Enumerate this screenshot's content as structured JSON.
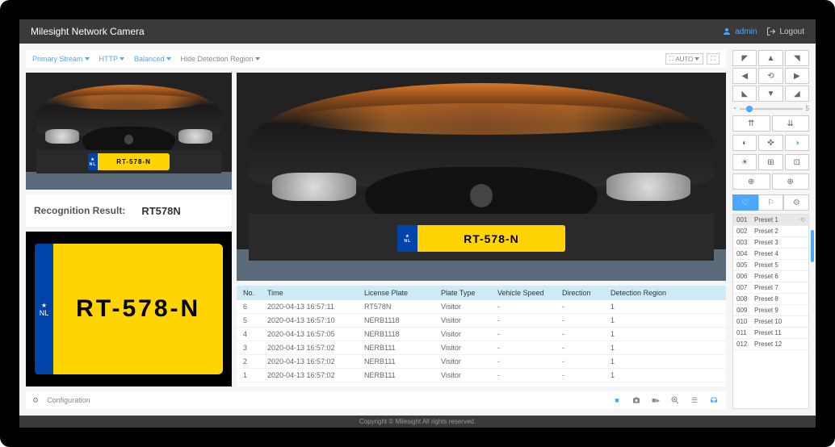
{
  "header": {
    "title": "Milesight Network Camera",
    "user": "admin",
    "logout": "Logout"
  },
  "toolbar": {
    "stream": "Primary Stream",
    "proto": "HTTP",
    "mode": "Balanced",
    "hide": "Hide Detection Region",
    "auto": "AUTO"
  },
  "plate": {
    "text": "RT-578-N",
    "country": "NL"
  },
  "recognition": {
    "label": "Recognition Result:",
    "value": "RT578N"
  },
  "table": {
    "headers": {
      "no": "No.",
      "time": "Time",
      "plate": "License Plate",
      "type": "Plate Type",
      "speed": "Vehicle Speed",
      "dir": "Direction",
      "region": "Detection Region"
    },
    "rows": [
      {
        "no": "6",
        "time": "2020-04-13 16:57:11",
        "plate": "RT578N",
        "type": "Visitor",
        "speed": "-",
        "dir": "-",
        "region": "1"
      },
      {
        "no": "5",
        "time": "2020-04-13 16:57:10",
        "plate": "NERB1118",
        "type": "Visitor",
        "speed": "-",
        "dir": "-",
        "region": "1"
      },
      {
        "no": "4",
        "time": "2020-04-13 16:57:05",
        "plate": "NERB1118",
        "type": "Visitor",
        "speed": "-",
        "dir": "-",
        "region": "1"
      },
      {
        "no": "3",
        "time": "2020-04-13 16:57:02",
        "plate": "NERB111",
        "type": "Visitor",
        "speed": "-",
        "dir": "-",
        "region": "1"
      },
      {
        "no": "2",
        "time": "2020-04-13 16:57:02",
        "plate": "NERB111",
        "type": "Visitor",
        "speed": "-",
        "dir": "-",
        "region": "1"
      },
      {
        "no": "1",
        "time": "2020-04-13 16:57:02",
        "plate": "NERB111",
        "type": "Visitor",
        "speed": "-",
        "dir": "-",
        "region": "1"
      }
    ]
  },
  "bottom": {
    "config": "Configuration"
  },
  "ptz": {
    "arrows": [
      "◤",
      "▲",
      "◥",
      "◀",
      "⟲",
      "▶",
      "◣",
      "▼",
      "◢"
    ],
    "speed": "5"
  },
  "controls": {
    "r1": [
      "⇈",
      "⇊"
    ],
    "r2": [
      "◐",
      "✜",
      "◑"
    ],
    "r3": [
      "☀",
      "⊞",
      "⊡"
    ],
    "r4": [
      "⊕",
      "⊕"
    ]
  },
  "tabs": [
    "♡",
    "⚐",
    "⚙"
  ],
  "presets": [
    {
      "id": "001",
      "name": "Preset 1"
    },
    {
      "id": "002",
      "name": "Preset 2"
    },
    {
      "id": "003",
      "name": "Preset 3"
    },
    {
      "id": "004",
      "name": "Preset 4"
    },
    {
      "id": "005",
      "name": "Preset 5"
    },
    {
      "id": "006",
      "name": "Preset 6"
    },
    {
      "id": "007",
      "name": "Preset 7"
    },
    {
      "id": "008",
      "name": "Preset 8"
    },
    {
      "id": "009",
      "name": "Preset 9"
    },
    {
      "id": "010",
      "name": "Preset 10"
    },
    {
      "id": "011",
      "name": "Preset 11"
    },
    {
      "id": "012",
      "name": "Preset 12"
    }
  ],
  "footer": "Copyright © Milesight All rights reserved."
}
